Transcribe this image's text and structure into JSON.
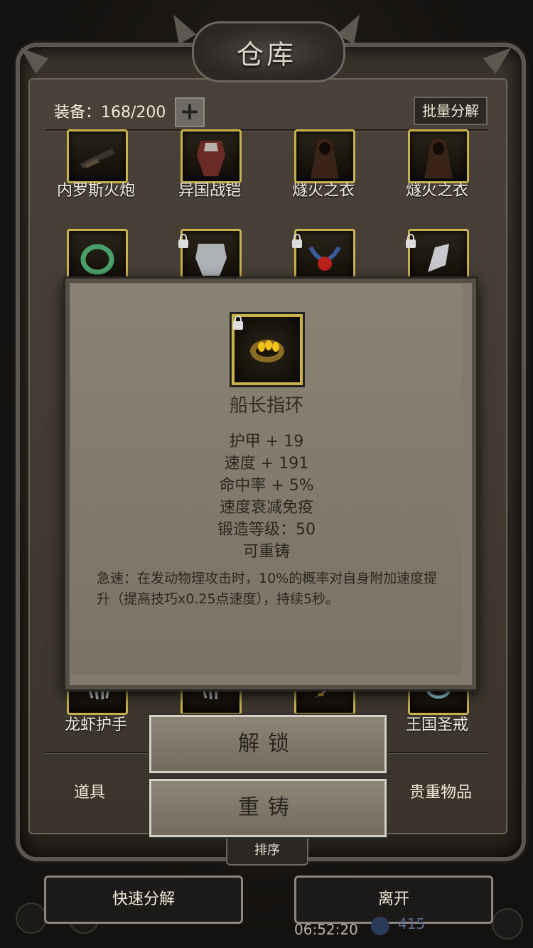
{
  "window": {
    "title": "仓库"
  },
  "header": {
    "equip_label": "装备：168/200",
    "plus_icon": "plus-icon",
    "batch_label": "批量分解"
  },
  "items_row1": [
    {
      "label": "内罗斯火炮",
      "icon": "cannon-icon"
    },
    {
      "label": "异国战铠",
      "icon": "armor-icon"
    },
    {
      "label": "燧火之衣",
      "icon": "cloak-icon"
    },
    {
      "label": "燧火之衣",
      "icon": "cloak-icon"
    }
  ],
  "items_row2_icons": [
    "ring-icon",
    "silver-armor-icon",
    "amulet-icon",
    "gauntlet-icon"
  ],
  "items_last": [
    {
      "label": "龙虾护手",
      "icon": "claw-gauntlet-icon"
    },
    {
      "label": "",
      "icon": "claw-icon"
    },
    {
      "label": "",
      "icon": "dagger-icon"
    },
    {
      "label": "王国圣戒",
      "icon": "holy-ring-icon"
    }
  ],
  "popup": {
    "name": "船长指环",
    "icon": "gold-ring-icon",
    "stats": [
      "护甲 + 19",
      "速度 + 191",
      "命中率 + 5%",
      "速度衰减免疫",
      "锻造等级：50",
      "可重铸"
    ],
    "description": "急速：在发动物理攻击时，10%的概率对自身附加速度提升（提高技巧x0.25点速度），持续5秒。",
    "unlock_label": "解锁",
    "reforge_label": "重铸"
  },
  "tabs": {
    "left": "道具",
    "right": "贵重物品",
    "sort": "排序"
  },
  "bottom": {
    "quick_decompose": "快速分解",
    "leave": "离开",
    "time": "06:52:20",
    "gem_count": "415"
  },
  "colors": {
    "slot_border": "#c9b24a",
    "popup_bg": "#827b6e"
  }
}
